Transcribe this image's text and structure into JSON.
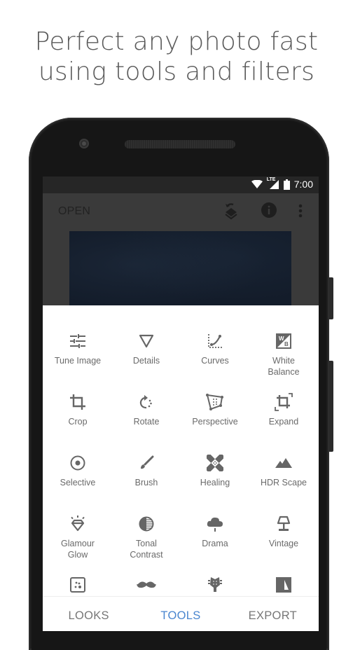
{
  "headline": {
    "line1": "Perfect any photo fast",
    "line2": "using tools and filters"
  },
  "statusbar": {
    "icons": [
      "wifi-icon",
      "lte-signal-icon",
      "battery-icon"
    ],
    "network_label": "LTE",
    "time": "7:00"
  },
  "appbar": {
    "open_label": "OPEN",
    "icons": [
      "undo-layers-icon",
      "info-icon",
      "more-vert-icon"
    ]
  },
  "tools": [
    {
      "label": "Tune Image",
      "icon": "tune-image-icon"
    },
    {
      "label": "Details",
      "icon": "details-triangle-icon"
    },
    {
      "label": "Curves",
      "icon": "curves-icon"
    },
    {
      "label": "White Balance",
      "icon": "white-balance-icon"
    },
    {
      "label": "Crop",
      "icon": "crop-icon"
    },
    {
      "label": "Rotate",
      "icon": "rotate-icon"
    },
    {
      "label": "Perspective",
      "icon": "perspective-icon"
    },
    {
      "label": "Expand",
      "icon": "expand-icon"
    },
    {
      "label": "Selective",
      "icon": "selective-icon"
    },
    {
      "label": "Brush",
      "icon": "brush-icon"
    },
    {
      "label": "Healing",
      "icon": "healing-bandage-icon"
    },
    {
      "label": "HDR Scape",
      "icon": "mountains-icon"
    },
    {
      "label": "Glamour Glow",
      "icon": "glamour-glow-diamond-icon"
    },
    {
      "label": "Tonal Contrast",
      "icon": "tonal-contrast-icon"
    },
    {
      "label": "Drama",
      "icon": "drama-cloud-icon"
    },
    {
      "label": "Vintage",
      "icon": "vintage-lamp-icon"
    },
    {
      "label": "",
      "icon": "grainy-film-icon"
    },
    {
      "label": "",
      "icon": "mustache-icon"
    },
    {
      "label": "",
      "icon": "guitar-head-icon"
    },
    {
      "label": "",
      "icon": "noir-icon"
    }
  ],
  "bottomnav": {
    "items": [
      {
        "label": "LOOKS",
        "active": false
      },
      {
        "label": "TOOLS",
        "active": true
      },
      {
        "label": "EXPORT",
        "active": false
      }
    ],
    "accent_color": "#4a86cf"
  }
}
